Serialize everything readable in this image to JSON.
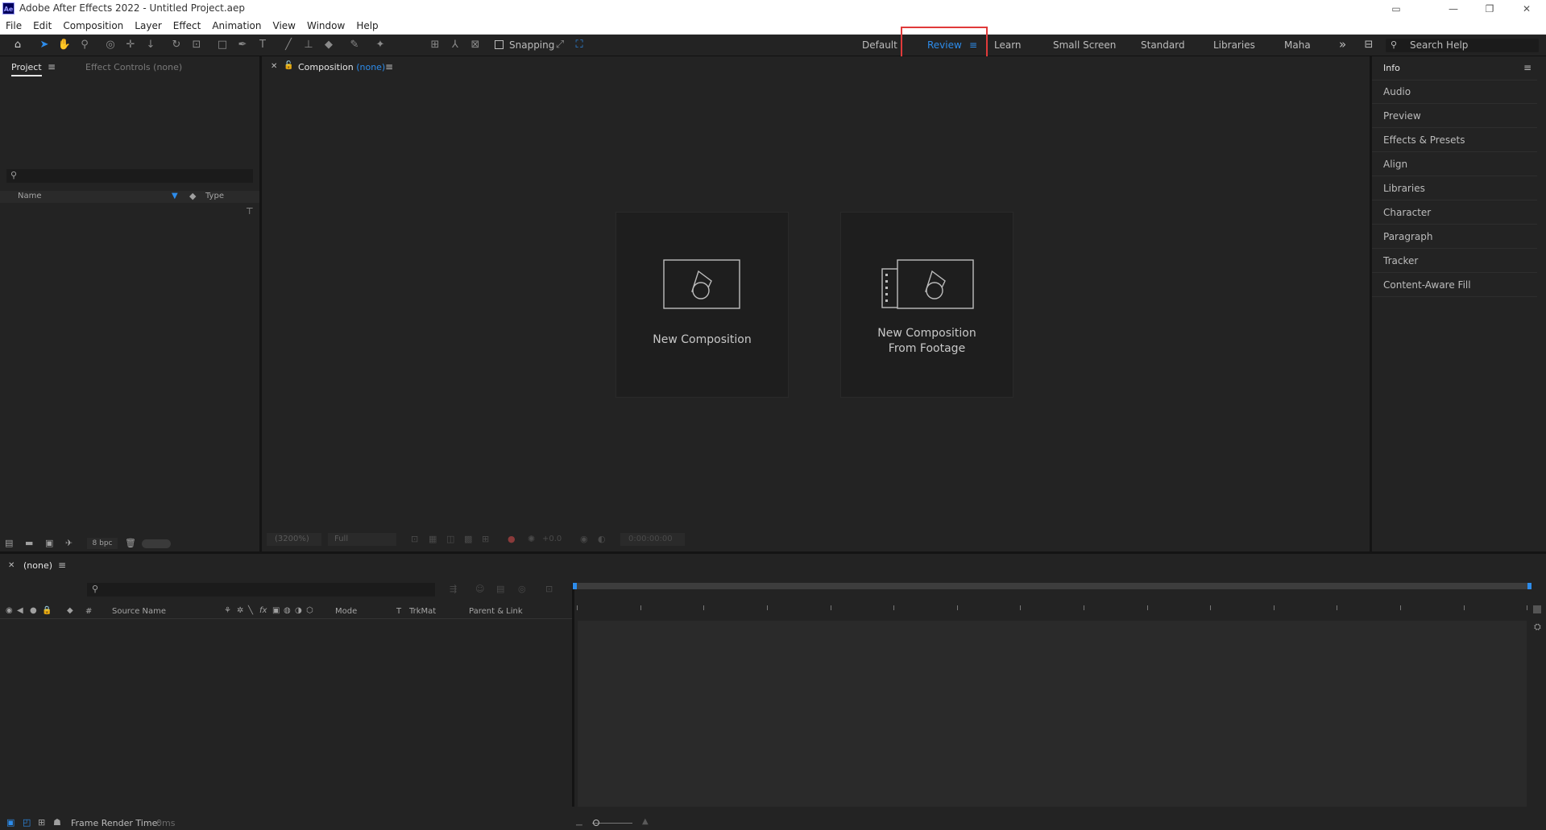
{
  "titlebar": {
    "app_icon_text": "Ae",
    "title": "Adobe After Effects 2022 - Untitled Project.aep"
  },
  "menu": [
    "File",
    "Edit",
    "Composition",
    "Layer",
    "Effect",
    "Animation",
    "View",
    "Window",
    "Help"
  ],
  "toolbar": {
    "snapping_label": "Snapping",
    "snapping_checked": false,
    "workspaces": [
      "Default",
      "Review",
      "Learn",
      "Small Screen",
      "Standard",
      "Libraries",
      "Maha"
    ],
    "active_workspace": "Review",
    "overflow_icon": "»",
    "search_placeholder": "Search Help"
  },
  "project_panel": {
    "tab_project": "Project",
    "tab_effect_controls": "Effect Controls",
    "effect_controls_target": "(none)",
    "col_name": "Name",
    "col_type": "Type",
    "bpc": "8 bpc"
  },
  "composition_panel": {
    "tab_label": "Composition",
    "tab_target": "(none)",
    "new_comp_label": "New Composition",
    "new_comp_footage_line1": "New Composition",
    "new_comp_footage_line2": "From Footage",
    "zoom": "(3200%)",
    "resolution": "Full",
    "exposure": "+0.0",
    "timecode": "0:00:00:00"
  },
  "right_panel": {
    "info_label": "Info",
    "items": [
      "Audio",
      "Preview",
      "Effects & Presets",
      "Align",
      "Libraries",
      "Character",
      "Paragraph",
      "Tracker",
      "Content-Aware Fill"
    ]
  },
  "timeline": {
    "tab_label": "(none)",
    "col_hash": "#",
    "col_source_name": "Source Name",
    "col_mode": "Mode",
    "col_t": "T",
    "col_trkmat": "TrkMat",
    "col_parent": "Parent & Link",
    "frame_render_label": "Frame Render Time:",
    "frame_render_value": "0ms"
  },
  "colors": {
    "accent": "#2d8ceb",
    "highlight_box": "#e03a3a",
    "panel_bg": "#232323"
  }
}
